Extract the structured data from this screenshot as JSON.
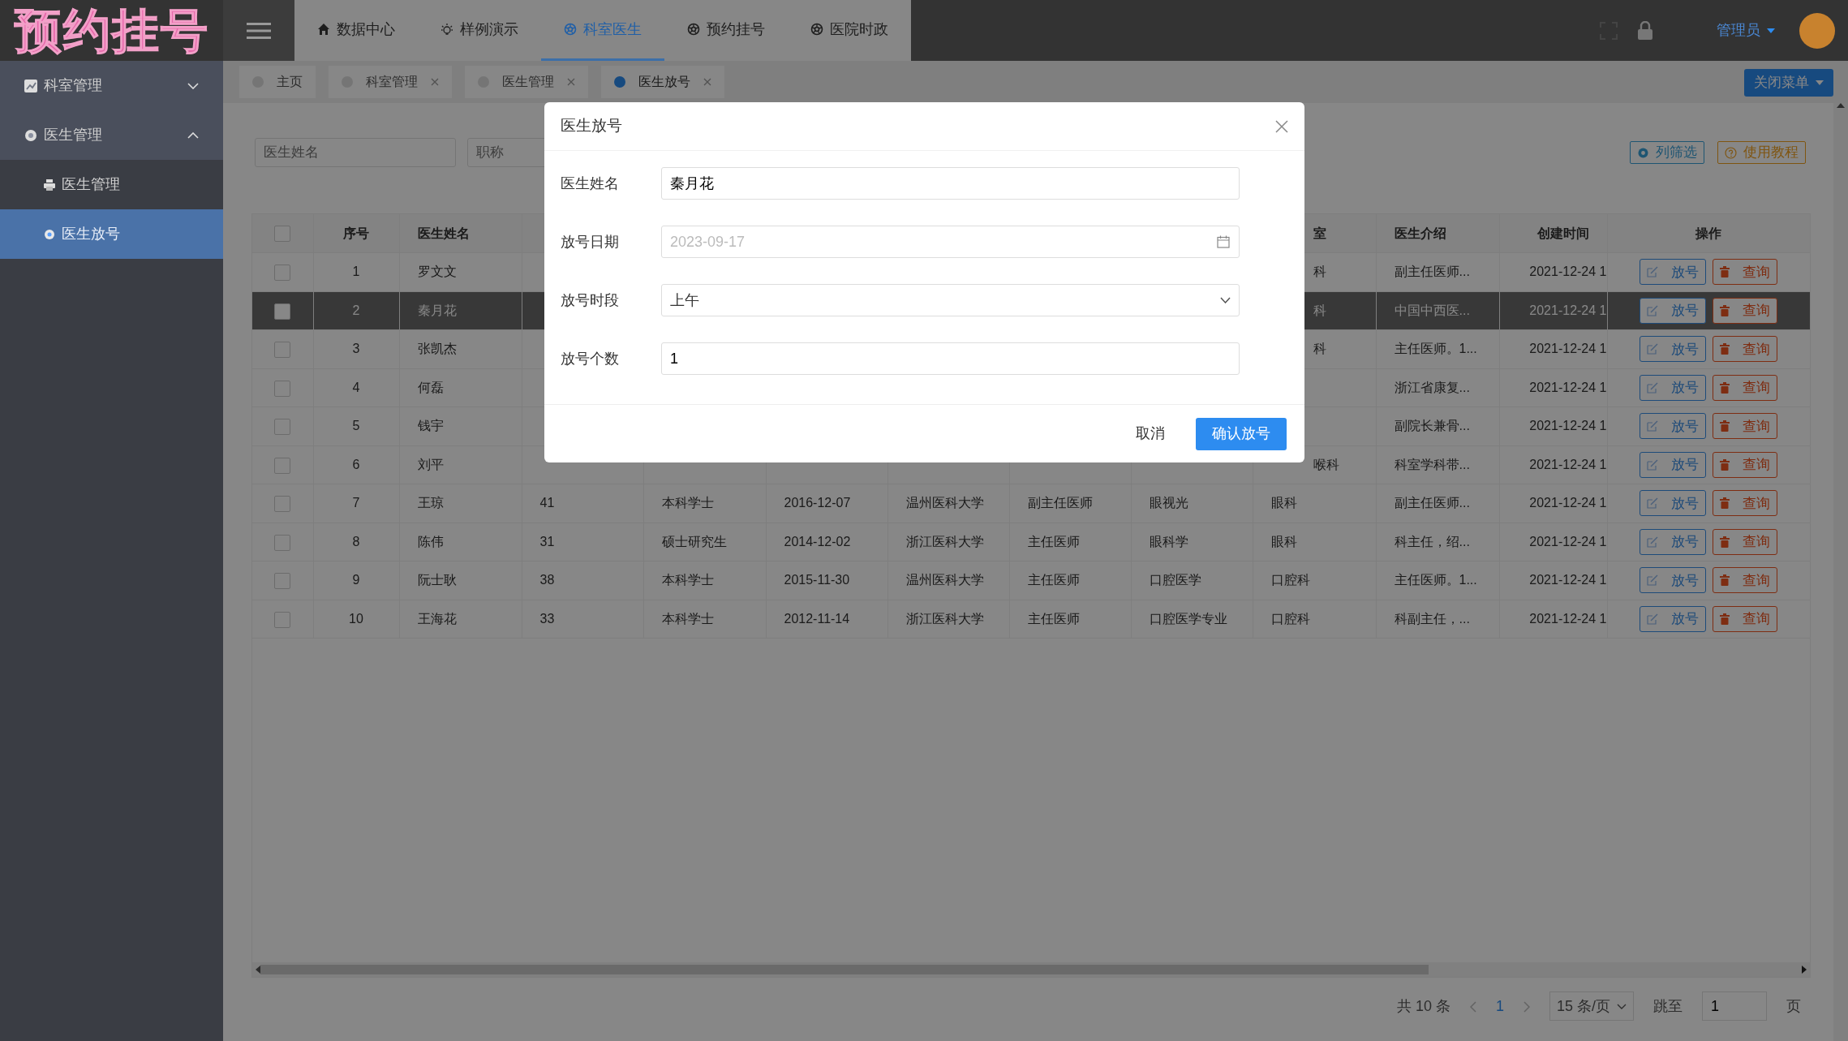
{
  "logo": "预约挂号",
  "top_nav": [
    {
      "label": "数据中心",
      "selected": false
    },
    {
      "label": "样例演示",
      "selected": false
    },
    {
      "label": "科室医生",
      "selected": true
    },
    {
      "label": "预约挂号",
      "selected": false
    },
    {
      "label": "医院时政",
      "selected": false
    }
  ],
  "user": {
    "name": "管理员"
  },
  "sidebar": {
    "items": [
      {
        "label": "科室管理",
        "expanded": false
      },
      {
        "label": "医生管理",
        "expanded": true,
        "children": [
          {
            "label": "医生管理",
            "selected": false
          },
          {
            "label": "医生放号",
            "selected": true
          }
        ]
      }
    ]
  },
  "page_tabs": [
    {
      "label": "主页",
      "selected": false,
      "closable": false
    },
    {
      "label": "科室管理",
      "selected": false,
      "closable": true
    },
    {
      "label": "医生管理",
      "selected": false,
      "closable": true
    },
    {
      "label": "医生放号",
      "selected": true,
      "closable": true
    }
  ],
  "close_menu_button": "关闭菜单",
  "filters": [
    {
      "placeholder": "医生姓名"
    },
    {
      "placeholder": "职称"
    }
  ],
  "toolbar_buttons": [
    {
      "label": "列筛选",
      "kind": "filter"
    },
    {
      "label": "使用教程",
      "kind": "help"
    }
  ],
  "table": {
    "header": {
      "checked": false,
      "index": "序号",
      "name": "医生姓名",
      "dept": "室",
      "intro": "医生介绍",
      "created": "创建时间",
      "actions": "操作"
    },
    "rows": [
      {
        "checked": false,
        "selected": false,
        "covered": true,
        "index": "1",
        "name": "罗文文",
        "dept": "科",
        "intro": "副主任医师...",
        "created": "2021-12-24 1",
        "actions": [
          "放号",
          "查询"
        ]
      },
      {
        "checked": false,
        "selected": true,
        "covered": true,
        "index": "2",
        "name": "秦月花",
        "dept": "科",
        "intro": "中国中西医...",
        "created": "2021-12-24 1",
        "actions": [
          "放号",
          "查询"
        ]
      },
      {
        "checked": false,
        "selected": false,
        "covered": true,
        "index": "3",
        "name": "张凯杰",
        "dept": "科",
        "intro": "主任医师。1...",
        "created": "2021-12-24 1",
        "actions": [
          "放号",
          "查询"
        ]
      },
      {
        "checked": false,
        "selected": false,
        "index": "4",
        "name": "何磊",
        "intro": "浙江省康复...",
        "created": "2021-12-24 1",
        "actions": [
          "放号",
          "查询"
        ]
      },
      {
        "checked": false,
        "selected": false,
        "index": "5",
        "name": "钱宇",
        "intro": "副院长兼骨...",
        "created": "2021-12-24 1",
        "actions": [
          "放号",
          "查询"
        ]
      },
      {
        "checked": false,
        "selected": false,
        "covered": true,
        "index": "6",
        "name": "刘平",
        "dept": "喉科",
        "intro": "科室学科带...",
        "created": "2021-12-24 1",
        "actions": [
          "放号",
          "查询"
        ]
      },
      {
        "checked": false,
        "selected": false,
        "covered": false,
        "index": "7",
        "name": "王琼",
        "age": "41",
        "degree": "本科学士",
        "date": "2016-12-07",
        "school": "温州医科大学",
        "title": "副主任医师",
        "major": "眼视光",
        "dept": "眼科",
        "intro": "副主任医师...",
        "created": "2021-12-24 1",
        "actions": [
          "放号",
          "查询"
        ]
      },
      {
        "checked": false,
        "selected": false,
        "covered": false,
        "index": "8",
        "name": "陈伟",
        "age": "31",
        "degree": "硕士研究生",
        "date": "2014-12-02",
        "school": "浙江医科大学",
        "title": "主任医师",
        "major": "眼科学",
        "dept": "眼科",
        "intro": "科主任，绍...",
        "created": "2021-12-24 1",
        "actions": [
          "放号",
          "查询"
        ]
      },
      {
        "checked": false,
        "selected": false,
        "covered": false,
        "index": "9",
        "name": "阮士耿",
        "age": "38",
        "degree": "本科学士",
        "date": "2015-11-30",
        "school": "温州医科大学",
        "title": "主任医师",
        "major": "口腔医学",
        "dept": "口腔科",
        "intro": "主任医师。1...",
        "created": "2021-12-24 1",
        "actions": [
          "放号",
          "查询"
        ]
      },
      {
        "checked": false,
        "selected": false,
        "covered": false,
        "index": "10",
        "name": "王海花",
        "age": "33",
        "degree": "本科学士",
        "date": "2012-11-14",
        "school": "浙江医科大学",
        "title": "主任医师",
        "major": "口腔医学专业",
        "dept": "口腔科",
        "intro": "科副主任，...",
        "created": "2021-12-24 1",
        "actions": [
          "放号",
          "查询"
        ]
      }
    ]
  },
  "pagination": {
    "total": "共 10 条",
    "pages": [
      {
        "label": "1",
        "selected": true
      }
    ],
    "page_size": "15 条/页",
    "jump_label": "跳至",
    "jump_value": "1",
    "page_suffix": "页"
  },
  "dialog": {
    "title": "医生放号",
    "fields": [
      {
        "label": "医生姓名",
        "kind": "text",
        "value": "秦月花"
      },
      {
        "label": "放号日期",
        "kind": "date",
        "placeholder": "2023-09-17"
      },
      {
        "label": "放号时段",
        "kind": "select",
        "value": "上午"
      },
      {
        "label": "放号个数",
        "kind": "text",
        "value": "1"
      }
    ],
    "buttons": [
      {
        "label": "取消",
        "kind": "default"
      },
      {
        "label": "确认放号",
        "kind": "primary"
      }
    ]
  }
}
